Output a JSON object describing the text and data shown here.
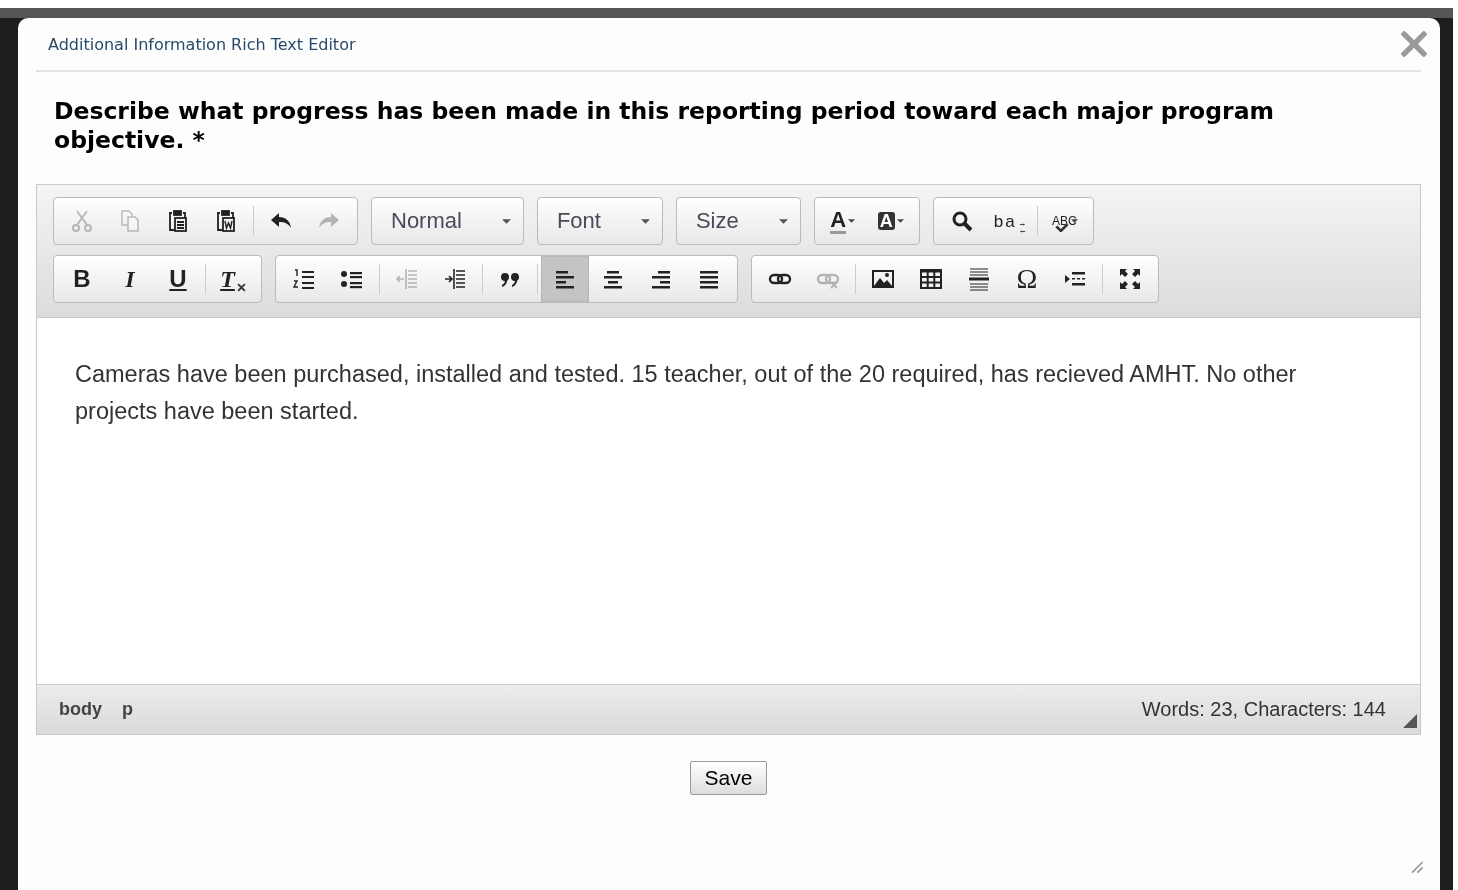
{
  "dialog": {
    "title": "Additional Information Rich Text Editor"
  },
  "question": "Describe what progress has been made in this reporting period toward each major program objective. *",
  "toolbar": [
    {
      "items": [
        {
          "kind": "group",
          "parts": [
            [
              {
                "kind": "cut",
                "disabled": true
              },
              {
                "kind": "copy",
                "disabled": true
              },
              {
                "kind": "paste",
                "disabled": false
              },
              {
                "kind": "paste-word",
                "disabled": false
              }
            ],
            [
              {
                "kind": "undo",
                "disabled": false
              },
              {
                "kind": "redo",
                "disabled": true
              }
            ]
          ]
        },
        {
          "kind": "combo",
          "label": "Normal"
        },
        {
          "kind": "combo",
          "label": "Font"
        },
        {
          "kind": "combo",
          "label": "Size"
        },
        {
          "kind": "group",
          "parts": [
            [
              {
                "kind": "text-color",
                "glyph": "A",
                "disabled": false
              },
              {
                "kind": "bg-color",
                "glyph": "A",
                "disabled": false
              }
            ]
          ]
        },
        {
          "kind": "group",
          "parts": [
            [
              {
                "kind": "find",
                "disabled": false
              },
              {
                "kind": "replace",
                "glyph": "ba",
                "disabled": false
              }
            ],
            [
              {
                "kind": "spellcheck",
                "glyph": "ABC",
                "disabled": false
              }
            ]
          ]
        }
      ]
    },
    {
      "items": [
        {
          "kind": "group",
          "parts": [
            [
              {
                "kind": "bold",
                "glyph": "B",
                "disabled": false
              },
              {
                "kind": "italic",
                "glyph": "I",
                "disabled": false
              },
              {
                "kind": "underline",
                "glyph": "U",
                "disabled": false
              }
            ],
            [
              {
                "kind": "remove-format",
                "glyph": "T",
                "disabled": false
              }
            ]
          ]
        },
        {
          "kind": "group",
          "parts": [
            [
              {
                "kind": "numbered-list",
                "disabled": false
              },
              {
                "kind": "bulleted-list",
                "disabled": false
              }
            ],
            [
              {
                "kind": "outdent",
                "disabled": true
              },
              {
                "kind": "indent",
                "disabled": false
              }
            ],
            [
              {
                "kind": "blockquote",
                "disabled": false
              }
            ],
            [
              {
                "kind": "align-left",
                "disabled": false,
                "selected": true
              },
              {
                "kind": "align-center",
                "disabled": false,
                "selected": false
              },
              {
                "kind": "align-right",
                "disabled": false,
                "selected": false
              },
              {
                "kind": "align-justify",
                "disabled": false,
                "selected": false
              }
            ]
          ]
        },
        {
          "kind": "group",
          "parts": [
            [
              {
                "kind": "link",
                "disabled": false
              },
              {
                "kind": "unlink",
                "disabled": true
              }
            ],
            [
              {
                "kind": "image",
                "disabled": false
              },
              {
                "kind": "table",
                "disabled": false
              },
              {
                "kind": "horizontal-line",
                "disabled": false
              },
              {
                "kind": "special-char",
                "glyph": "Ω",
                "disabled": false
              },
              {
                "kind": "page-break",
                "disabled": false
              }
            ],
            [
              {
                "kind": "maximize",
                "disabled": false
              }
            ]
          ]
        }
      ]
    }
  ],
  "content": "Cameras have been purchased, installed and tested. 15 teacher, out of the 20 required, has recieved AMHT. No other projects have been started.",
  "status_bar": {
    "path": [
      "body",
      "p"
    ],
    "count": "Words: 23, Characters: 144"
  },
  "buttons": [
    "Save"
  ]
}
